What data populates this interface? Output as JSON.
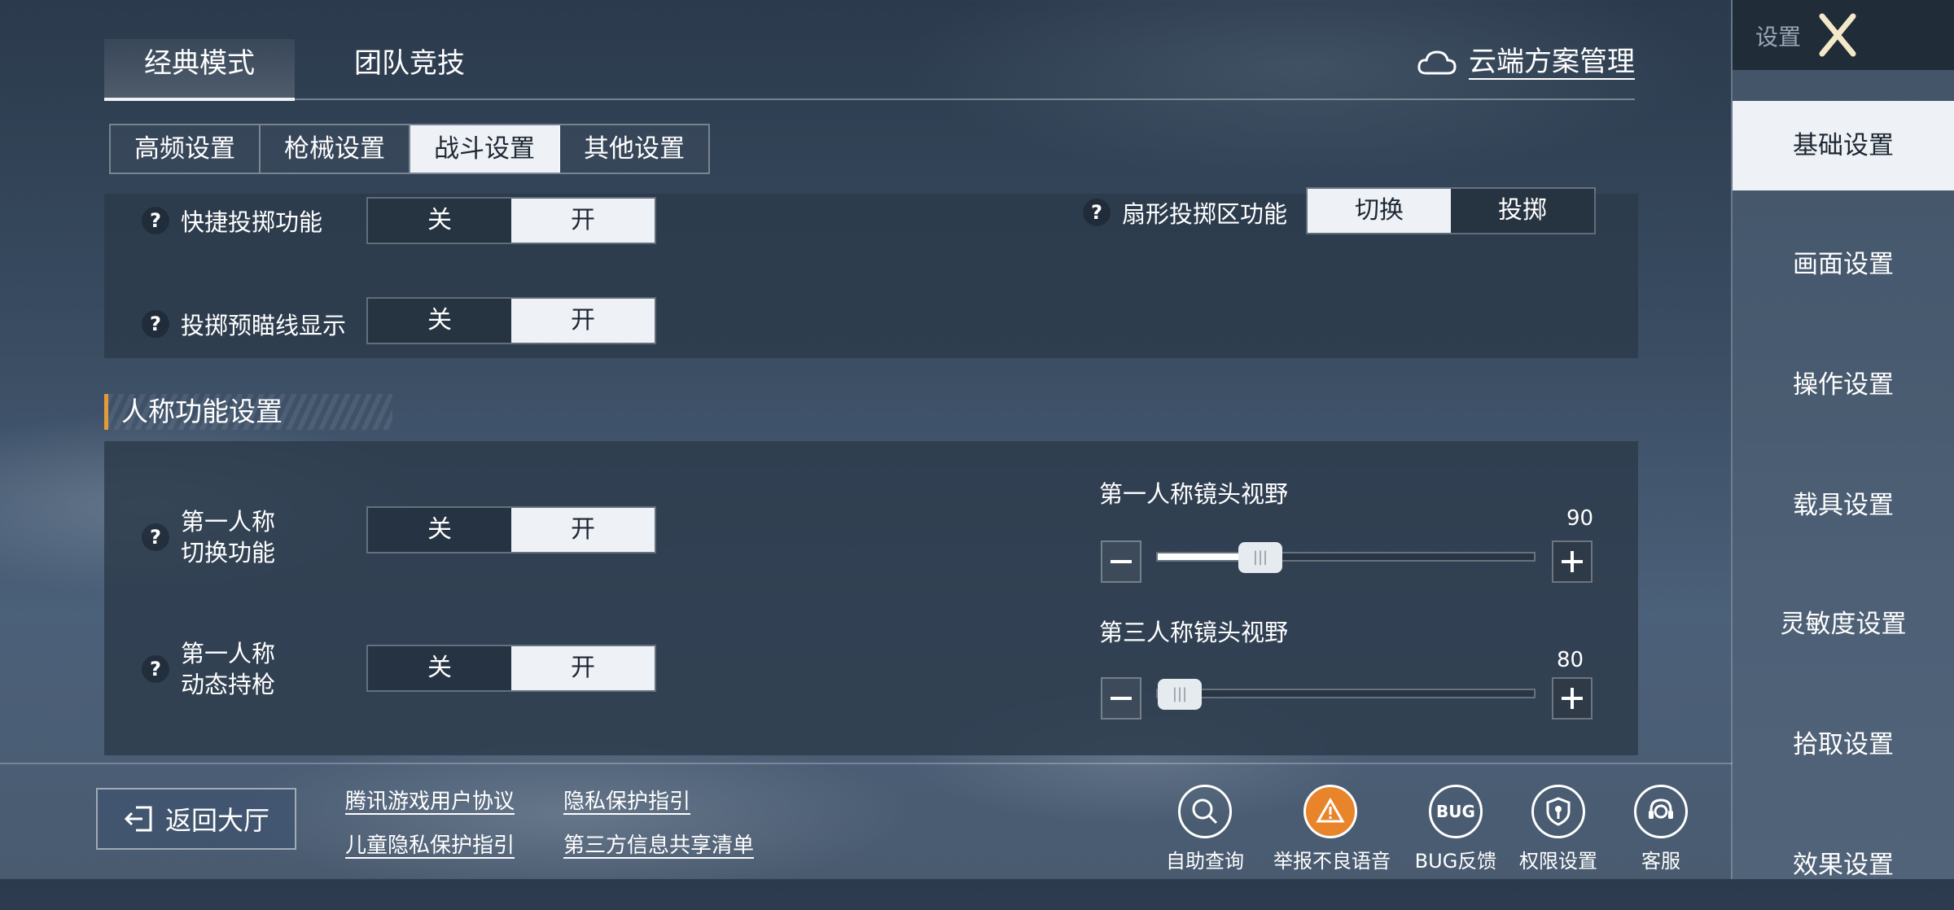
{
  "mode_tabs": [
    "经典模式",
    "团队竞技"
  ],
  "cloud_label": "云端方案管理",
  "sub_tabs": [
    "高频设置",
    "枪械设置",
    "战斗设置",
    "其他设置"
  ],
  "rows": {
    "quick_throw": {
      "label": "快捷投掷功能",
      "off": "关",
      "on": "开"
    },
    "throw_aim_line": {
      "label": "投掷预瞄线显示",
      "off": "关",
      "on": "开"
    },
    "fan_throw": {
      "label": "扇形投掷区功能",
      "opt1": "切换",
      "opt2": "投掷"
    },
    "fp_switch": {
      "label1": "第一人称",
      "label2": "切换功能",
      "off": "关",
      "on": "开"
    },
    "fp_dynamic": {
      "label1": "第一人称",
      "label2": "动态持枪",
      "off": "关",
      "on": "开"
    }
  },
  "question_mark": "?",
  "section_title": "人称功能设置",
  "sliders": {
    "fp_fov": {
      "title": "第一人称镜头视野",
      "value": "90",
      "fill_fraction": 0.27
    },
    "tp_fov": {
      "title": "第三人称镜头视野",
      "value": "80",
      "fill_fraction": 0.0
    }
  },
  "sidebar": {
    "title": "设置",
    "items": [
      "基础设置",
      "画面设置",
      "操作设置",
      "载具设置",
      "灵敏度设置",
      "拾取设置",
      "效果设置"
    ]
  },
  "footer": {
    "back_label": "返回大厅",
    "links": [
      "腾讯游戏用户协议",
      "隐私保护指引",
      "儿童隐私保护指引",
      "第三方信息共享清单"
    ],
    "icons": [
      {
        "label": "自助查询",
        "icon": "search-icon"
      },
      {
        "label": "举报不良语音",
        "icon": "report-voice-icon"
      },
      {
        "label": "BUG反馈",
        "icon": "bug-icon"
      },
      {
        "label": "权限设置",
        "icon": "permission-icon"
      },
      {
        "label": "客服",
        "icon": "customer-service-icon"
      }
    ],
    "bug_text": "BUG"
  },
  "colors": {
    "accent": "#e39a3b",
    "active_tab": "#eef2f6"
  }
}
